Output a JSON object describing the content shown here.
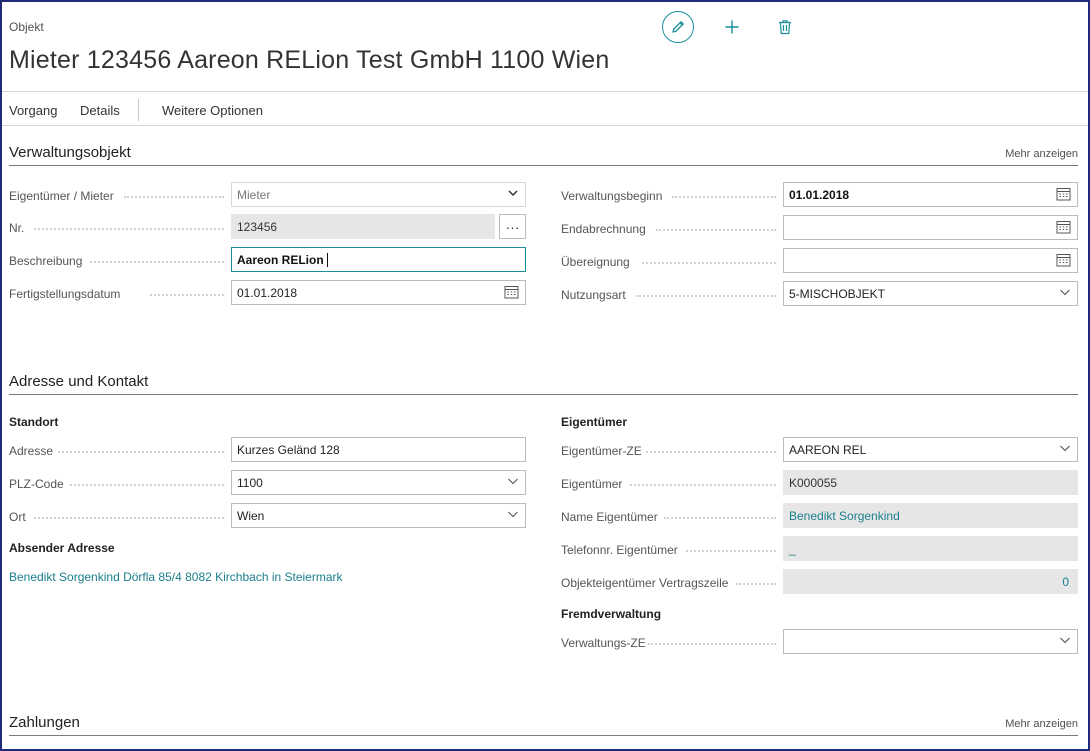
{
  "header": {
    "caption": "Objekt",
    "title": "Mieter 123456 Aareon RELion Test GmbH 1100 Wien",
    "icons": [
      "pencil-icon",
      "plus-icon",
      "trash-icon"
    ]
  },
  "actionbar": {
    "items": [
      "Vorgang",
      "Details",
      "Weitere Optionen"
    ]
  },
  "sections": {
    "verwaltung": {
      "title": "Verwaltungsobjekt",
      "more": "Mehr anzeigen"
    },
    "adresse": {
      "title": "Adresse und Kontakt"
    },
    "zahlungen": {
      "title": "Zahlungen",
      "more": "Mehr anzeigen"
    }
  },
  "verwaltung": {
    "eigentuemer_mieter": {
      "label": "Eigentümer / Mieter",
      "value": "Mieter"
    },
    "nr": {
      "label": "Nr.",
      "value": "123456",
      "button": "···"
    },
    "beschreibung": {
      "label": "Beschreibung",
      "value": "Aareon RELion"
    },
    "fertigstellung": {
      "label": "Fertigstellungsdatum",
      "value": "01.01.2018"
    },
    "verwaltungsbeginn": {
      "label": "Verwaltungsbeginn",
      "value": "01.01.2018"
    },
    "endabrechnung": {
      "label": "Endabrechnung",
      "value": ""
    },
    "uebereignung": {
      "label": "Übereignung",
      "value": ""
    },
    "nutzungsart": {
      "label": "Nutzungsart",
      "value": "5-MISCHOBJEKT"
    }
  },
  "adresse": {
    "standort": "Standort",
    "adresse": {
      "label": "Adresse",
      "value": "Kurzes Geländ 128"
    },
    "plz": {
      "label": "PLZ-Code",
      "value": "1100"
    },
    "ort": {
      "label": "Ort",
      "value": "Wien"
    },
    "absender_head": "Absender Adresse",
    "absender_value": "Benedikt Sorgenkind Dörfla 85/4 8082 Kirchbach in Steiermark",
    "eigentuemer_head": "Eigentümer",
    "eigentuemer_ze": {
      "label": "Eigentümer-ZE",
      "value": "AAREON REL"
    },
    "eigentuemer": {
      "label": "Eigentümer",
      "value": "K000055"
    },
    "name_eigentuemer": {
      "label": "Name Eigentümer",
      "value": "Benedikt Sorgenkind"
    },
    "telefon": {
      "label": "Telefonnr. Eigentümer",
      "value": "_"
    },
    "vertragszeile": {
      "label": "Objekteigentümer Vertragszeile",
      "value": "0"
    },
    "fremd_head": "Fremdverwaltung",
    "verwaltungs_ze": {
      "label": "Verwaltungs-ZE",
      "value": ""
    }
  },
  "colors": {
    "accent": "#1a8e9b",
    "link": "#1a7f8c",
    "frame": "#1e2a78"
  }
}
